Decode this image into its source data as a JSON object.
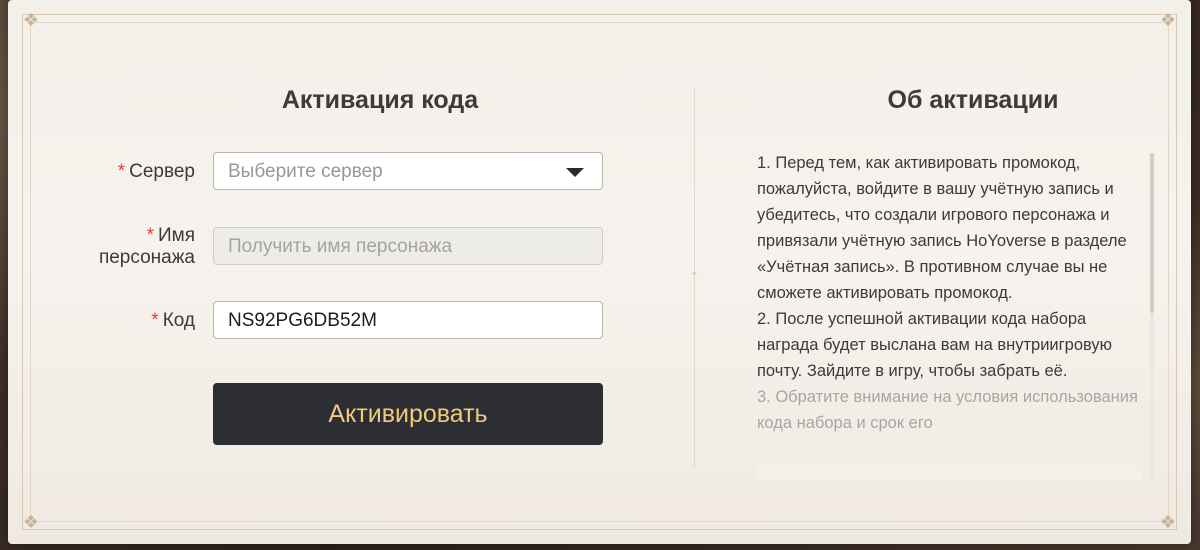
{
  "activation": {
    "title": "Активация кода",
    "server": {
      "required_mark": "*",
      "label": "Сервер",
      "placeholder": "Выберите сервер"
    },
    "character": {
      "required_mark": "*",
      "label_line1": "Имя",
      "label_line2": "персонажа",
      "placeholder": "Получить имя персонажа"
    },
    "code": {
      "required_mark": "*",
      "label": "Код",
      "value": "NS92PG6DB52M"
    },
    "submit_label": "Активировать"
  },
  "about": {
    "title": "Об активации",
    "paragraphs": [
      "1. Перед тем, как активировать промокод, пожалуйста, войдите в вашу учётную запись и убедитесь, что создали игрового персонажа и привязали учётную запись HoYoverse в разделе «Учётная запись». В противном случае вы не сможете активировать промокод.",
      "2. После успешной активации кода набора награда будет выслана вам на внутриигровую почту. Зайдите в игру, чтобы забрать её.",
      "3. Обратите внимание на условия использования кода набора и срок его"
    ]
  },
  "colors": {
    "accent_button": "#2d2e33",
    "button_text": "#f0c97e",
    "required_star": "#e0403f"
  },
  "icons": {
    "dropdown": "triangle-down-icon",
    "corner": "ornament-corner-icon"
  }
}
